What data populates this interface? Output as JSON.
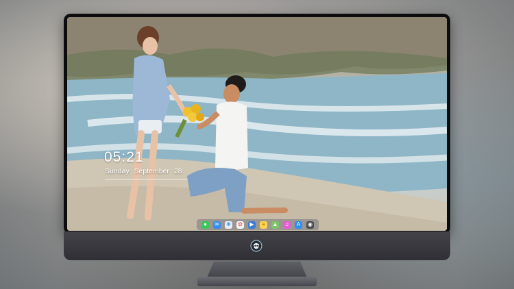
{
  "lock_screen": {
    "time": "05:21",
    "day": "Sunday",
    "month": "September",
    "date": "28"
  },
  "dock": {
    "apps": [
      {
        "icon": "messages-icon",
        "color": "#39c65a"
      },
      {
        "icon": "mail-icon",
        "color": "#2f8cf0"
      },
      {
        "icon": "safari-icon",
        "color": "#e8eef5"
      },
      {
        "icon": "photos-icon",
        "color": "#f2f2f2"
      },
      {
        "icon": "clapper-icon",
        "color": "#3a7bd5"
      },
      {
        "icon": "notes-icon",
        "color": "#ffd34d"
      },
      {
        "icon": "gallery-icon",
        "color": "#7cc46a"
      },
      {
        "icon": "music-icon",
        "color": "#e95ad4"
      },
      {
        "icon": "app-store-icon",
        "color": "#2e8ff0"
      },
      {
        "icon": "camera-icon",
        "color": "#4b4b4f"
      }
    ]
  },
  "colors": {
    "bezel": "#0c0c0e",
    "chin": "#3a3a40"
  }
}
